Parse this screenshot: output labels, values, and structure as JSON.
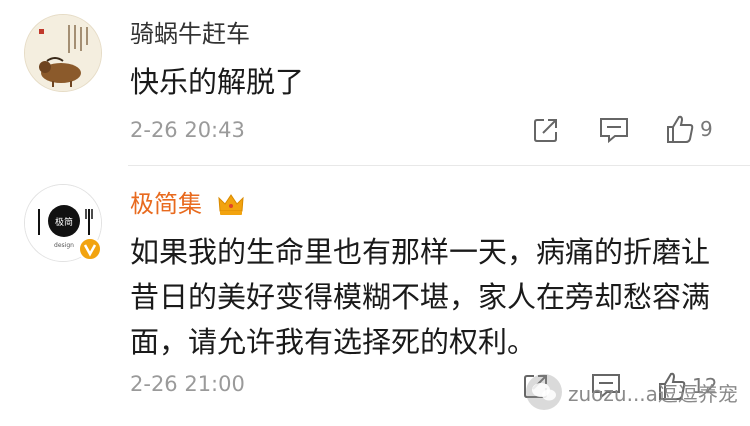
{
  "comments": [
    {
      "username": "骑蜗牛赶车",
      "content": "快乐的解脱了",
      "timestamp": "2-26 20:43",
      "like_count": "9"
    },
    {
      "username": "极简集",
      "content": "如果我的生命里也有那样一天，病痛的折磨让昔日的美好变得模糊不堪，家人在旁却愁容满面，请允许我有选择死的权利。",
      "timestamp": "2-26 21:00",
      "like_count": "12",
      "avatar_text": "极简",
      "avatar_subtext": "design"
    }
  ],
  "watermark": {
    "text": "zuozu...a逗逗养宠"
  },
  "icons": {
    "share": "share-icon",
    "comment": "comment-icon",
    "like": "like-icon",
    "crown": "crown-icon",
    "verified": "verified-badge-icon"
  },
  "colors": {
    "username_highlight": "#e86a1e",
    "text": "#1a1a1a",
    "meta": "#9a9a9a",
    "crown": "#f2a30f"
  }
}
